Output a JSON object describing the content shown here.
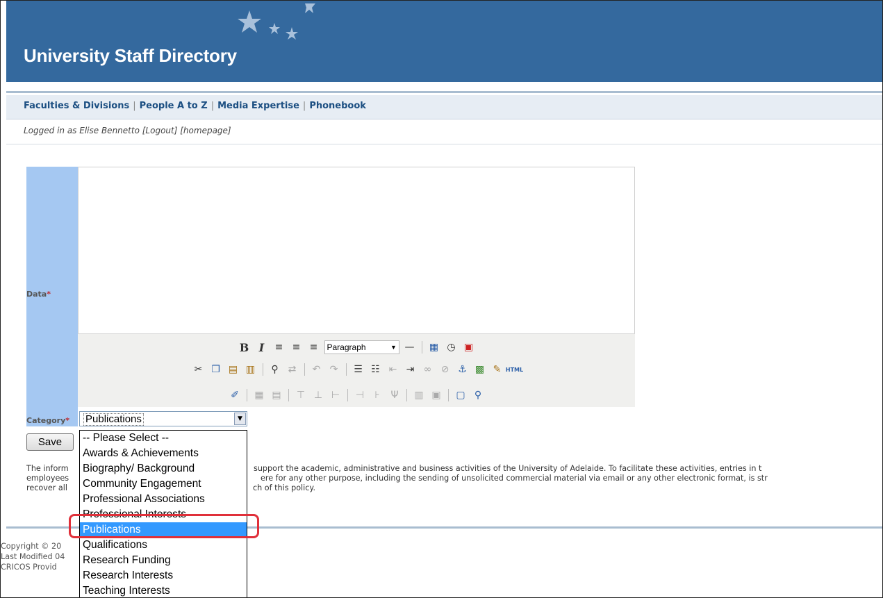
{
  "header": {
    "title": "University Staff Directory"
  },
  "nav": {
    "links": [
      "Faculties & Divisions",
      "People A to Z",
      "Media Expertise",
      "Phonebook"
    ],
    "separator": "|"
  },
  "session": {
    "logged_in_prefix": "Logged in as Elise Bennetto",
    "logout_label": "[Logout]",
    "homepage_label": "[homepage]"
  },
  "form": {
    "data_label": "Data",
    "category_label": "Category",
    "required_marker": "*",
    "category_selected": "Publications",
    "save_label": "Save",
    "format_select_value": "Paragraph"
  },
  "dropdown": {
    "options": [
      "-- Please Select --",
      "Awards & Achievements",
      "Biography/ Background",
      "Community Engagement",
      "Professional Associations",
      "Professional Interests",
      "Publications",
      "Qualifications",
      "Research Funding",
      "Research Interests",
      "Teaching Interests"
    ],
    "highlighted": "Publications"
  },
  "policy": {
    "line1_start": "The inform",
    "line1_end": "support the academic, administrative and business activities of the University of Adelaide. To facilitate these activities, entries in t",
    "line2_start": "employees",
    "line2_end": "ere for any other purpose, including the sending of unsolicited commercial material via email or any other electronic format, is str",
    "line3_start": "recover all",
    "line3_end": "ch of this policy."
  },
  "footer": {
    "copyright": "Copyright © 20",
    "last_modified": "Last Modified 04",
    "cricos": "CRICOS Provid"
  },
  "toolbar_icons": {
    "row1": [
      "bold-icon",
      "italic-icon",
      "align-left-icon",
      "align-center-icon",
      "align-right-icon",
      "format-select",
      "horizontal-rule-icon",
      "insert-date-icon",
      "insert-time-icon",
      "paste-word-icon"
    ],
    "row2": [
      "cut-icon",
      "copy-icon",
      "paste-icon",
      "paste-text-icon",
      "find-icon",
      "replace-icon",
      "undo-icon",
      "redo-icon",
      "bullet-list-icon",
      "numbered-list-icon",
      "outdent-icon",
      "indent-icon",
      "link-icon",
      "unlink-icon",
      "anchor-icon",
      "image-icon",
      "cleanup-icon",
      "html-source-icon"
    ],
    "row3": [
      "edit-icon",
      "table-icon",
      "table-props-icon",
      "row-before-icon",
      "row-after-icon",
      "delete-row-icon",
      "col-before-icon",
      "col-after-icon",
      "delete-col-icon",
      "split-cells-icon",
      "merge-cells-icon",
      "fullscreen-icon",
      "preview-icon"
    ]
  },
  "colors": {
    "header_bg": "#34699e",
    "label_column": "#a5c8f2",
    "link": "#1c4f82",
    "selection": "#3399ff",
    "annotation": "#e0303a"
  }
}
